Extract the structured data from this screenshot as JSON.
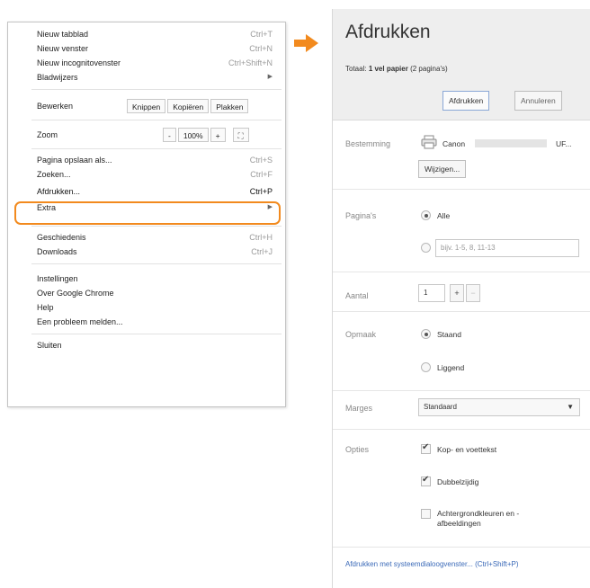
{
  "menu": {
    "new_tab": {
      "label": "Nieuw tabblad",
      "shortcut": "Ctrl+T"
    },
    "new_window": {
      "label": "Nieuw venster",
      "shortcut": "Ctrl+N"
    },
    "new_incognito": {
      "label": "Nieuw incognitovenster",
      "shortcut": "Ctrl+Shift+N"
    },
    "bookmarks": {
      "label": "Bladwijzers"
    },
    "edit": {
      "label": "Bewerken",
      "cut": "Knippen",
      "copy": "Kopiëren",
      "paste": "Plakken"
    },
    "zoom": {
      "label": "Zoom",
      "minus": "-",
      "value": "100%",
      "plus": "+",
      "fullscreen": "⛶"
    },
    "save_page": {
      "label": "Pagina opslaan als...",
      "shortcut": "Ctrl+S"
    },
    "find": {
      "label": "Zoeken...",
      "shortcut": "Ctrl+F"
    },
    "print": {
      "label": "Afdrukken...",
      "shortcut": "Ctrl+P"
    },
    "extra": {
      "label": "Extra"
    },
    "history": {
      "label": "Geschiedenis",
      "shortcut": "Ctrl+H"
    },
    "downloads": {
      "label": "Downloads",
      "shortcut": "Ctrl+J"
    },
    "settings": {
      "label": "Instellingen"
    },
    "about": {
      "label": "Over Google Chrome"
    },
    "help": {
      "label": "Help"
    },
    "report": {
      "label": "Een probleem melden..."
    },
    "exit": {
      "label": "Sluiten"
    },
    "highlight_color": "#f28a1e"
  },
  "arrow": {
    "color": "#f28a1e"
  },
  "dialog": {
    "title": "Afdrukken",
    "total_label": "Totaal:",
    "total_value": "1 vel papier",
    "total_pages": "(2 pagina's)",
    "print_button": "Afdrukken",
    "cancel_button": "Annuleren",
    "destination": {
      "label": "Bestemming",
      "printer_name": "Canon",
      "printer_suffix": "UF...",
      "change_button": "Wijzigen..."
    },
    "pages": {
      "label": "Pagina's",
      "all": "Alle",
      "range_placeholder": "bijv. 1-5, 8, 11-13"
    },
    "copies": {
      "label": "Aantal",
      "value": "1",
      "plus": "+",
      "minus": "−"
    },
    "layout": {
      "label": "Opmaak",
      "portrait": "Staand",
      "landscape": "Liggend"
    },
    "margins": {
      "label": "Marges",
      "value": "Standaard"
    },
    "options": {
      "label": "Opties",
      "header_footer": "Kop- en voettekst",
      "duplex": "Dubbelzijdig",
      "bg_line1": "Achtergrondkleuren en -",
      "bg_line2": "afbeeldingen"
    },
    "system_dialog_link": "Afdrukken met systeemdialoogvenster... (Ctrl+Shift+P)"
  }
}
